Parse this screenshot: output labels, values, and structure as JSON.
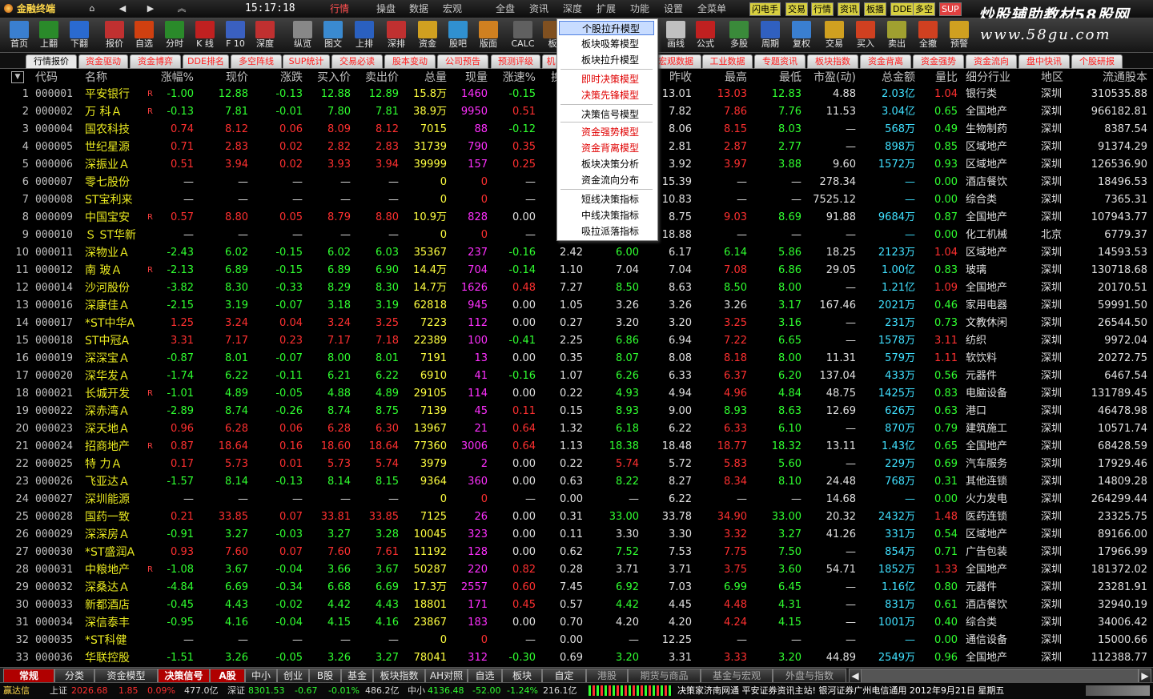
{
  "menubar": {
    "app": "金融终端",
    "time": "15:17:18",
    "items": [
      "行情",
      "操盘",
      "数据",
      "宏观",
      "全盘",
      "资讯",
      "深度",
      "扩展",
      "功能",
      "设置",
      "全菜单"
    ],
    "quick": [
      "闪电手",
      "交易",
      "行情",
      "资讯",
      "板播",
      "DDE",
      "多空",
      "SUP"
    ],
    "watermark1": "炒股辅助教材58股网",
    "watermark2": "www.58gu.com"
  },
  "toolbar": [
    "首页",
    "上翻",
    "下翻",
    "报价",
    "自选",
    "分时",
    "K 线",
    "F 10",
    "深度",
    "纵览",
    "图文",
    "上排",
    "深排",
    "资金",
    "股吧",
    "版面",
    "CALC",
    "板",
    "",
    "",
    "",
    "画线",
    "公式",
    "多股",
    "周期",
    "复权",
    "交易",
    "买入",
    "卖出",
    "全撤",
    "预警"
  ],
  "tabs": [
    "行情报价",
    "资金驱动",
    "资金博弈",
    "DDE排名",
    "多空阵线",
    "SUP统计",
    "交易必读",
    "股本变动",
    "公司预告",
    "预测评级",
    "机",
    "",
    "",
    "",
    "宏观数据",
    "工业数据",
    "专题资讯",
    "板块指数",
    "资金背离",
    "资金强势",
    "资金流向",
    "盘中快讯",
    "个股研报"
  ],
  "header": [
    "代码",
    "名称",
    "涨幅%",
    "现价",
    "涨跌",
    "买入价",
    "卖出价",
    "总量",
    "现量",
    "涨速%",
    "换",
    "",
    "",
    "昨收",
    "最高",
    "最低",
    "市盈(动)",
    "总金额",
    "量比",
    "细分行业",
    "地区",
    "流通股本"
  ],
  "context_menu": [
    "个股拉升模型",
    "板块吸筹模型",
    "板块拉升模型",
    "即时决策模型",
    "决策先锋模型",
    "决策信号模型",
    "资金强势模型",
    "资金背离模型",
    "板块决策分析",
    "资金流向分布",
    "短线决策指标",
    "中线决策指标",
    "吸拉派落指标"
  ],
  "rows": [
    [
      "1",
      "000001",
      "平安银行",
      "R",
      "-1.00",
      "12.88",
      "-0.13",
      "12.88",
      "12.89",
      "15.8万",
      "1460",
      "-0.15",
      "",
      "",
      "13.01",
      "13.03",
      "12.83",
      "4.88",
      "2.03亿",
      "1.04",
      "银行类",
      "深圳",
      "310535.88"
    ],
    [
      "2",
      "000002",
      "万  科Ａ",
      "R",
      "-0.13",
      "7.81",
      "-0.01",
      "7.80",
      "7.81",
      "38.9万",
      "9950",
      "0.51",
      "",
      "",
      "7.82",
      "7.86",
      "7.76",
      "11.53",
      "3.04亿",
      "0.65",
      "全国地产",
      "深圳",
      "966182.81"
    ],
    [
      "3",
      "000004",
      "国农科技",
      "",
      "0.74",
      "8.12",
      "0.06",
      "8.09",
      "8.12",
      "7015",
      "88",
      "-0.12",
      "",
      "",
      "8.06",
      "8.15",
      "8.03",
      "—",
      "568万",
      "0.49",
      "生物制药",
      "深圳",
      "8387.54"
    ],
    [
      "4",
      "000005",
      "世纪星源",
      "",
      "0.71",
      "2.83",
      "0.02",
      "2.82",
      "2.83",
      "31739",
      "790",
      "0.35",
      "",
      "",
      "2.81",
      "2.87",
      "2.77",
      "—",
      "898万",
      "0.85",
      "区域地产",
      "深圳",
      "91374.29"
    ],
    [
      "5",
      "000006",
      "深振业Ａ",
      "",
      "0.51",
      "3.94",
      "0.02",
      "3.93",
      "3.94",
      "39999",
      "157",
      "0.25",
      "",
      "",
      "3.92",
      "3.97",
      "3.88",
      "9.60",
      "1572万",
      "0.93",
      "区域地产",
      "深圳",
      "126536.90"
    ],
    [
      "6",
      "000007",
      "零七股份",
      "",
      "—",
      "—",
      "—",
      "—",
      "—",
      "0",
      "0",
      "—",
      "",
      "",
      "15.39",
      "—",
      "—",
      "278.34",
      "—",
      "0.00",
      "酒店餐饮",
      "深圳",
      "18496.53"
    ],
    [
      "7",
      "000008",
      "ST宝利来",
      "",
      "—",
      "—",
      "—",
      "—",
      "—",
      "0",
      "0",
      "—",
      "",
      "",
      "10.83",
      "—",
      "—",
      "7525.12",
      "—",
      "0.00",
      "综合类",
      "深圳",
      "7365.31"
    ],
    [
      "8",
      "000009",
      "中国宝安",
      "R",
      "0.57",
      "8.80",
      "0.05",
      "8.79",
      "8.80",
      "10.9万",
      "828",
      "0.00",
      "",
      "",
      "8.75",
      "9.03",
      "8.69",
      "91.88",
      "9684万",
      "0.87",
      "全国地产",
      "深圳",
      "107943.77"
    ],
    [
      "9",
      "000010",
      "Ｓ ST华新",
      "",
      "—",
      "—",
      "—",
      "—",
      "—",
      "0",
      "0",
      "—",
      "",
      "",
      "18.88",
      "—",
      "—",
      "—",
      "—",
      "0.00",
      "化工机械",
      "北京",
      "6779.37"
    ],
    [
      "10",
      "000011",
      "深物业Ａ",
      "",
      "-2.43",
      "6.02",
      "-0.15",
      "6.02",
      "6.03",
      "35367",
      "237",
      "-0.16",
      "2.42",
      "6.00",
      "6.17",
      "6.14",
      "5.86",
      "18.25",
      "2123万",
      "1.04",
      "区域地产",
      "深圳",
      "14593.53"
    ],
    [
      "11",
      "000012",
      "南  玻Ａ",
      "R",
      "-2.13",
      "6.89",
      "-0.15",
      "6.89",
      "6.90",
      "14.4万",
      "704",
      "-0.14",
      "1.10",
      "7.04",
      "7.04",
      "7.08",
      "6.86",
      "29.05",
      "1.00亿",
      "0.83",
      "玻璃",
      "深圳",
      "130718.68"
    ],
    [
      "12",
      "000014",
      "沙河股份",
      "",
      "-3.82",
      "8.30",
      "-0.33",
      "8.29",
      "8.30",
      "14.7万",
      "1626",
      "0.48",
      "7.27",
      "8.50",
      "8.63",
      "8.50",
      "8.00",
      "—",
      "1.21亿",
      "1.09",
      "全国地产",
      "深圳",
      "20170.51"
    ],
    [
      "13",
      "000016",
      "深康佳Ａ",
      "",
      "-2.15",
      "3.19",
      "-0.07",
      "3.18",
      "3.19",
      "62818",
      "945",
      "0.00",
      "1.05",
      "3.26",
      "3.26",
      "3.26",
      "3.17",
      "167.46",
      "2021万",
      "0.46",
      "家用电器",
      "深圳",
      "59991.50"
    ],
    [
      "14",
      "000017",
      "*ST中华A",
      "",
      "1.25",
      "3.24",
      "0.04",
      "3.24",
      "3.25",
      "7223",
      "112",
      "0.00",
      "0.27",
      "3.20",
      "3.20",
      "3.25",
      "3.16",
      "—",
      "231万",
      "0.73",
      "文教休闲",
      "深圳",
      "26544.50"
    ],
    [
      "15",
      "000018",
      "ST中冠A",
      "",
      "3.31",
      "7.17",
      "0.23",
      "7.17",
      "7.18",
      "22389",
      "100",
      "-0.41",
      "2.25",
      "6.86",
      "6.94",
      "7.22",
      "6.65",
      "—",
      "1578万",
      "3.11",
      "纺织",
      "深圳",
      "9972.04"
    ],
    [
      "16",
      "000019",
      "深深宝Ａ",
      "",
      "-0.87",
      "8.01",
      "-0.07",
      "8.00",
      "8.01",
      "7191",
      "13",
      "0.00",
      "0.35",
      "8.07",
      "8.08",
      "8.18",
      "8.00",
      "11.31",
      "579万",
      "1.11",
      "软饮料",
      "深圳",
      "20272.75"
    ],
    [
      "17",
      "000020",
      "深华发Ａ",
      "",
      "-1.74",
      "6.22",
      "-0.11",
      "6.21",
      "6.22",
      "6910",
      "41",
      "-0.16",
      "1.07",
      "6.26",
      "6.33",
      "6.37",
      "6.20",
      "137.04",
      "433万",
      "0.56",
      "元器件",
      "深圳",
      "6467.54"
    ],
    [
      "18",
      "000021",
      "长城开发",
      "R",
      "-1.01",
      "4.89",
      "-0.05",
      "4.88",
      "4.89",
      "29105",
      "114",
      "0.00",
      "0.22",
      "4.93",
      "4.94",
      "4.96",
      "4.84",
      "48.75",
      "1425万",
      "0.83",
      "电脑设备",
      "深圳",
      "131789.45"
    ],
    [
      "19",
      "000022",
      "深赤湾Ａ",
      "",
      "-2.89",
      "8.74",
      "-0.26",
      "8.74",
      "8.75",
      "7139",
      "45",
      "0.11",
      "0.15",
      "8.93",
      "9.00",
      "8.93",
      "8.63",
      "12.69",
      "626万",
      "0.63",
      "港口",
      "深圳",
      "46478.98"
    ],
    [
      "20",
      "000023",
      "深天地Ａ",
      "",
      "0.96",
      "6.28",
      "0.06",
      "6.28",
      "6.30",
      "13967",
      "21",
      "0.64",
      "1.32",
      "6.18",
      "6.22",
      "6.33",
      "6.10",
      "—",
      "870万",
      "0.79",
      "建筑施工",
      "深圳",
      "10571.74"
    ],
    [
      "21",
      "000024",
      "招商地产",
      "R",
      "0.87",
      "18.64",
      "0.16",
      "18.60",
      "18.64",
      "77360",
      "3006",
      "0.64",
      "1.13",
      "18.38",
      "18.48",
      "18.77",
      "18.32",
      "13.11",
      "1.43亿",
      "0.65",
      "全国地产",
      "深圳",
      "68428.59"
    ],
    [
      "22",
      "000025",
      "特  力Ａ",
      "",
      "0.17",
      "5.73",
      "0.01",
      "5.73",
      "5.74",
      "3979",
      "2",
      "0.00",
      "0.22",
      "5.74",
      "5.72",
      "5.83",
      "5.60",
      "—",
      "229万",
      "0.69",
      "汽车服务",
      "深圳",
      "17929.46"
    ],
    [
      "23",
      "000026",
      "飞亚达Ａ",
      "",
      "-1.57",
      "8.14",
      "-0.13",
      "8.14",
      "8.15",
      "9364",
      "360",
      "0.00",
      "0.63",
      "8.22",
      "8.27",
      "8.34",
      "8.10",
      "24.48",
      "768万",
      "0.31",
      "其他连锁",
      "深圳",
      "14809.28"
    ],
    [
      "24",
      "000027",
      "深圳能源",
      "",
      "—",
      "—",
      "—",
      "—",
      "—",
      "0",
      "0",
      "—",
      "0.00",
      "—",
      "6.22",
      "—",
      "—",
      "14.68",
      "—",
      "0.00",
      "火力发电",
      "深圳",
      "264299.44"
    ],
    [
      "25",
      "000028",
      "国药一致",
      "",
      "0.21",
      "33.85",
      "0.07",
      "33.81",
      "33.85",
      "7125",
      "26",
      "0.00",
      "0.31",
      "33.00",
      "33.78",
      "34.90",
      "33.00",
      "20.32",
      "2432万",
      "1.48",
      "医药连锁",
      "深圳",
      "23325.75"
    ],
    [
      "26",
      "000029",
      "深深房Ａ",
      "",
      "-0.91",
      "3.27",
      "-0.03",
      "3.27",
      "3.28",
      "10045",
      "323",
      "0.00",
      "0.11",
      "3.30",
      "3.30",
      "3.32",
      "3.27",
      "41.26",
      "331万",
      "0.54",
      "区域地产",
      "深圳",
      "89166.00"
    ],
    [
      "27",
      "000030",
      "*ST盛润A",
      "",
      "0.93",
      "7.60",
      "0.07",
      "7.60",
      "7.61",
      "11192",
      "128",
      "0.00",
      "0.62",
      "7.52",
      "7.53",
      "7.75",
      "7.50",
      "—",
      "854万",
      "0.71",
      "广告包装",
      "深圳",
      "17966.99"
    ],
    [
      "28",
      "000031",
      "中粮地产",
      "R",
      "-1.08",
      "3.67",
      "-0.04",
      "3.66",
      "3.67",
      "50287",
      "220",
      "0.82",
      "0.28",
      "3.71",
      "3.71",
      "3.75",
      "3.60",
      "54.71",
      "1852万",
      "1.33",
      "全国地产",
      "深圳",
      "181372.02"
    ],
    [
      "29",
      "000032",
      "深桑达Ａ",
      "",
      "-4.84",
      "6.69",
      "-0.34",
      "6.68",
      "6.69",
      "17.3万",
      "2557",
      "0.60",
      "7.45",
      "6.92",
      "7.03",
      "6.99",
      "6.45",
      "—",
      "1.16亿",
      "0.80",
      "元器件",
      "深圳",
      "23281.91"
    ],
    [
      "30",
      "000033",
      "新都酒店",
      "",
      "-0.45",
      "4.43",
      "-0.02",
      "4.42",
      "4.43",
      "18801",
      "171",
      "0.45",
      "0.57",
      "4.42",
      "4.45",
      "4.48",
      "4.31",
      "—",
      "831万",
      "0.61",
      "酒店餐饮",
      "深圳",
      "32940.19"
    ],
    [
      "31",
      "000034",
      "深信泰丰",
      "",
      "-0.95",
      "4.16",
      "-0.04",
      "4.15",
      "4.16",
      "23867",
      "183",
      "0.00",
      "0.70",
      "4.20",
      "4.20",
      "4.24",
      "4.15",
      "—",
      "1001万",
      "0.40",
      "综合类",
      "深圳",
      "34006.42"
    ],
    [
      "32",
      "000035",
      "*ST科健",
      "",
      "—",
      "—",
      "—",
      "—",
      "—",
      "0",
      "0",
      "—",
      "0.00",
      "—",
      "12.25",
      "—",
      "—",
      "—",
      "—",
      "0.00",
      "通信设备",
      "深圳",
      "15000.66"
    ],
    [
      "33",
      "000036",
      "华联控股",
      "",
      "-1.51",
      "3.26",
      "-0.05",
      "3.26",
      "3.27",
      "78041",
      "312",
      "-0.30",
      "0.69",
      "3.20",
      "3.31",
      "3.33",
      "3.20",
      "44.89",
      "2549万",
      "0.96",
      "全国地产",
      "深圳",
      "112388.77"
    ]
  ],
  "bottom_tabs": [
    "常规",
    "分类",
    "资金模型",
    "决策信号",
    "A股",
    "中小",
    "创业",
    "B股",
    "基金",
    "板块指数",
    "AH对照",
    "自选",
    "板块",
    "自定",
    "港股",
    "期货与商品",
    "基金与宏观",
    "外盘与指数"
  ],
  "status": {
    "brand": "赢达信",
    "sh_label": "上证",
    "sh_val": "2026.68",
    "sh_chg": "1.85",
    "sh_pct": "0.09%",
    "sh_amt": "477.0亿",
    "sz_label": "深证",
    "sz_val": "8301.53",
    "sz_chg": "-0.67",
    "sz_pct": "-0.01%",
    "sz_amt": "486.2亿",
    "zx_label": "中小",
    "zx_val": "4136.48",
    "zx_chg": "-52.00",
    "zx_pct": "-1.24%",
    "zx_amt": "216.1亿",
    "ticker": "决策家济南网通  平安证券资讯主站!  银河证券广州电信通用  2012年9月21日 星期五"
  },
  "colors": {
    "up": "#ff3030",
    "down": "#30ff30",
    "name": "#e8e820",
    "amount": "#40e0ff",
    "volume": "#ff30ff"
  }
}
